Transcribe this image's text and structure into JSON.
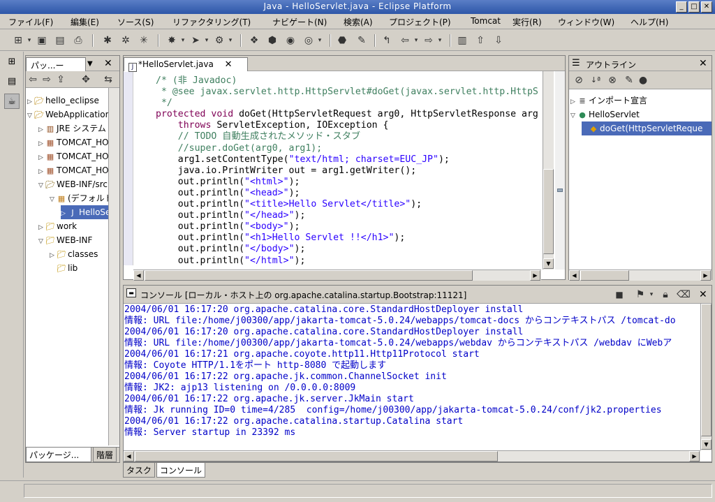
{
  "window": {
    "title": "Java - HelloServlet.java - Eclipse Platform"
  },
  "menu": [
    "ファイル(F)",
    "編集(E)",
    "ソース(S)",
    "リファクタリング(T)",
    "ナビゲート(N)",
    "検索(A)",
    "プロジェクト(P)",
    "Tomcat",
    "実行(R)",
    "ウィンドウ(W)",
    "ヘルプ(H)"
  ],
  "package_explorer": {
    "title": "パッ...ー",
    "tree": [
      {
        "label": "hello_eclipse",
        "indent": 0,
        "icon": "project-folder-icon",
        "expanded": false
      },
      {
        "label": "WebApplication",
        "indent": 0,
        "icon": "project-folder-icon",
        "expanded": true
      },
      {
        "label": "JRE システム",
        "indent": 1,
        "icon": "library-icon",
        "expanded": false
      },
      {
        "label": "TOMCAT_HOME/c",
        "indent": 1,
        "icon": "jar-icon",
        "expanded": false
      },
      {
        "label": "TOMCAT_HOME/c",
        "indent": 1,
        "icon": "jar-icon",
        "expanded": false
      },
      {
        "label": "TOMCAT_HOME/c",
        "indent": 1,
        "icon": "jar-icon",
        "expanded": false
      },
      {
        "label": "WEB-INF/src",
        "indent": 1,
        "icon": "source-folder-icon",
        "expanded": true
      },
      {
        "label": "(デフォルト",
        "indent": 2,
        "icon": "package-icon",
        "expanded": true
      },
      {
        "label": "HelloSer",
        "indent": 3,
        "icon": "java-file-icon",
        "expanded": false,
        "selected": true
      },
      {
        "label": "work",
        "indent": 1,
        "icon": "folder-icon",
        "expanded": false
      },
      {
        "label": "WEB-INF",
        "indent": 1,
        "icon": "folder-icon",
        "expanded": true
      },
      {
        "label": "classes",
        "indent": 2,
        "icon": "folder-icon",
        "expanded": false
      },
      {
        "label": "lib",
        "indent": 2,
        "icon": "folder-icon",
        "leaf": true
      }
    ],
    "tabs": [
      "パッケージ...",
      "階層"
    ]
  },
  "editor": {
    "tab_label": "*HelloServlet.java",
    "lines": [
      [
        {
          "t": "/* (非 Javadoc)",
          "c": "c-com"
        }
      ],
      [
        {
          "t": " * @see javax.servlet.http.HttpServlet#doGet(javax.servlet.http.HttpS",
          "c": "c-com"
        }
      ],
      [
        {
          "t": " */",
          "c": "c-com"
        }
      ],
      [
        {
          "t": "protected void ",
          "c": "c-kw"
        },
        {
          "t": "doGet(HttpServletRequest arg0, HttpServletResponse arg",
          "c": "c-txt"
        }
      ],
      [
        {
          "t": "    throws ",
          "c": "c-kw"
        },
        {
          "t": "ServletException, IOException {",
          "c": "c-txt"
        }
      ],
      [
        {
          "t": "    // TODO 自動生成されたメソッド・スタブ",
          "c": "c-com"
        }
      ],
      [
        {
          "t": "    //super.doGet(arg0, arg1);",
          "c": "c-com"
        }
      ],
      [
        {
          "t": "    arg1.setContentType(",
          "c": "c-txt"
        },
        {
          "t": "\"text/html; charset=EUC_JP\"",
          "c": "c-str"
        },
        {
          "t": ");",
          "c": "c-txt"
        }
      ],
      [
        {
          "t": "    java.io.PrintWriter out = arg1.getWriter();",
          "c": "c-txt"
        }
      ],
      [
        {
          "t": "    out.println(",
          "c": "c-txt"
        },
        {
          "t": "\"<html>\"",
          "c": "c-str"
        },
        {
          "t": ");",
          "c": "c-txt"
        }
      ],
      [
        {
          "t": "    out.println(",
          "c": "c-txt"
        },
        {
          "t": "\"<head>\"",
          "c": "c-str"
        },
        {
          "t": ");",
          "c": "c-txt"
        }
      ],
      [
        {
          "t": "    out.println(",
          "c": "c-txt"
        },
        {
          "t": "\"<title>Hello Servlet</title>\"",
          "c": "c-str"
        },
        {
          "t": ");",
          "c": "c-txt"
        }
      ],
      [
        {
          "t": "    out.println(",
          "c": "c-txt"
        },
        {
          "t": "\"</head>\"",
          "c": "c-str"
        },
        {
          "t": ");",
          "c": "c-txt"
        }
      ],
      [
        {
          "t": "    out.println(",
          "c": "c-txt"
        },
        {
          "t": "\"<body>\"",
          "c": "c-str"
        },
        {
          "t": ");",
          "c": "c-txt"
        }
      ],
      [
        {
          "t": "    out.println(",
          "c": "c-txt"
        },
        {
          "t": "\"<h1>Hello Servlet !!</h1>\"",
          "c": "c-str"
        },
        {
          "t": ");",
          "c": "c-txt"
        }
      ],
      [
        {
          "t": "    out.println(",
          "c": "c-txt"
        },
        {
          "t": "\"</body>\"",
          "c": "c-str"
        },
        {
          "t": ");",
          "c": "c-txt"
        }
      ],
      [
        {
          "t": "    out.println(",
          "c": "c-txt"
        },
        {
          "t": "\"</html>\"",
          "c": "c-str"
        },
        {
          "t": ");",
          "c": "c-txt"
        }
      ]
    ]
  },
  "outline": {
    "title": "アウトライン",
    "items": [
      {
        "label": "インポート宣言",
        "indent": 0,
        "icon": "imports-icon",
        "expanded": false
      },
      {
        "label": "HelloServlet",
        "indent": 0,
        "icon": "class-icon",
        "expanded": true
      },
      {
        "label": "doGet(HttpServletReque",
        "indent": 1,
        "icon": "method-icon",
        "selected": true
      }
    ]
  },
  "console": {
    "title": "コンソール [ローカル・ホスト上の org.apache.catalina.startup.Bootstrap:11121]",
    "lines": [
      "2004/06/01 16:17:20 org.apache.catalina.core.StandardHostDeployer install",
      "情報: URL file:/home/j00300/app/jakarta-tomcat-5.0.24/webapps/tomcat-docs からコンテキストパス /tomcat-do",
      "2004/06/01 16:17:20 org.apache.catalina.core.StandardHostDeployer install",
      "情報: URL file:/home/j00300/app/jakarta-tomcat-5.0.24/webapps/webdav からコンテキストパス /webdav にWebア",
      "2004/06/01 16:17:21 org.apache.coyote.http11.Http11Protocol start",
      "情報: Coyote HTTP/1.1をポート http-8080 で起動します",
      "2004/06/01 16:17:22 org.apache.jk.common.ChannelSocket init",
      "情報: JK2: ajp13 listening on /0.0.0.0:8009",
      "2004/06/01 16:17:22 org.apache.jk.server.JkMain start",
      "情報: Jk running ID=0 time=4/285  config=/home/j00300/app/jakarta-tomcat-5.0.24/conf/jk2.properties",
      "2004/06/01 16:17:22 org.apache.catalina.startup.Catalina start",
      "情報: Server startup in 23392 ms"
    ],
    "tabs": [
      "タスク",
      "コンソール"
    ]
  },
  "colors": {
    "title_bar": "#2d56a8",
    "selection": "#4a6ab8",
    "console_text": "#0000c8"
  }
}
